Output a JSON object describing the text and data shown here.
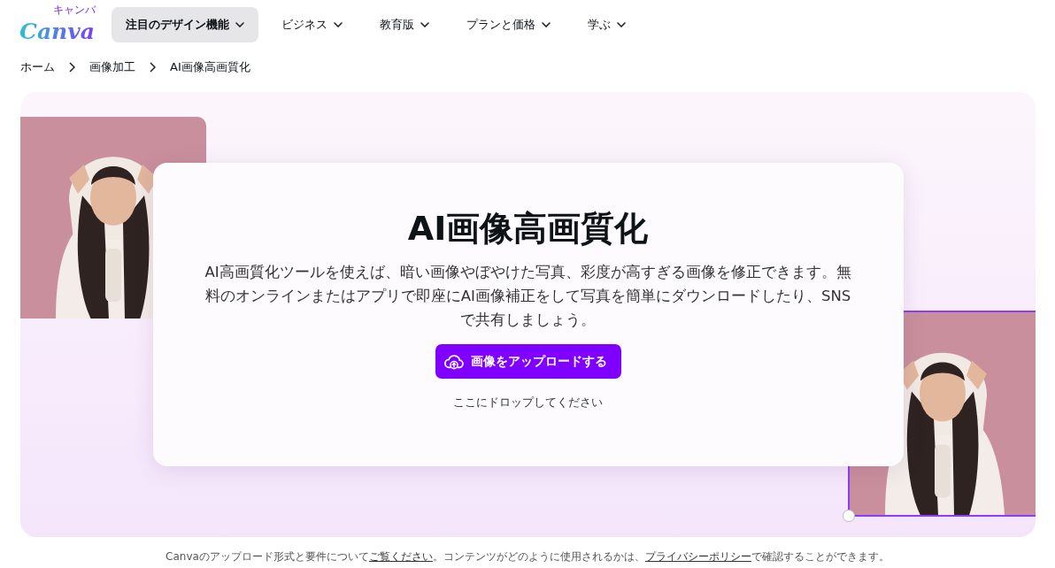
{
  "header": {
    "logo": {
      "wordmark": "Canva",
      "kana": "キャンバ"
    },
    "nav": [
      {
        "label": "注目のデザイン機能",
        "selected": true
      },
      {
        "label": "ビジネス",
        "selected": false
      },
      {
        "label": "教育版",
        "selected": false
      },
      {
        "label": "プランと価格",
        "selected": false
      },
      {
        "label": "学ぶ",
        "selected": false
      }
    ]
  },
  "breadcrumb": [
    "ホーム",
    "画像加工",
    "AI画像高画質化"
  ],
  "hero": {
    "title": "AI画像高画質化",
    "description": "AI高画質化ツールを使えば、暗い画像やぼやけた写真、彩度が高すぎる画像を修正できます。無料のオンラインまたはアプリで即座にAI画像補正をして写真を簡単にダウンロードしたり、SNSで共有しましょう。",
    "upload_button": "画像をアップロードする",
    "drop_hint": "ここにドロップしてください"
  },
  "footer_note": [
    {
      "text": "Canvaのアップロード形式と要件について",
      "link": false
    },
    {
      "text": "ご覧ください",
      "link": true
    },
    {
      "text": "。コンテンツがどのように使用されるかは、",
      "link": false
    },
    {
      "text": "プライバシーポリシー",
      "link": true
    },
    {
      "text": "で確認することができます。",
      "link": false
    }
  ]
}
